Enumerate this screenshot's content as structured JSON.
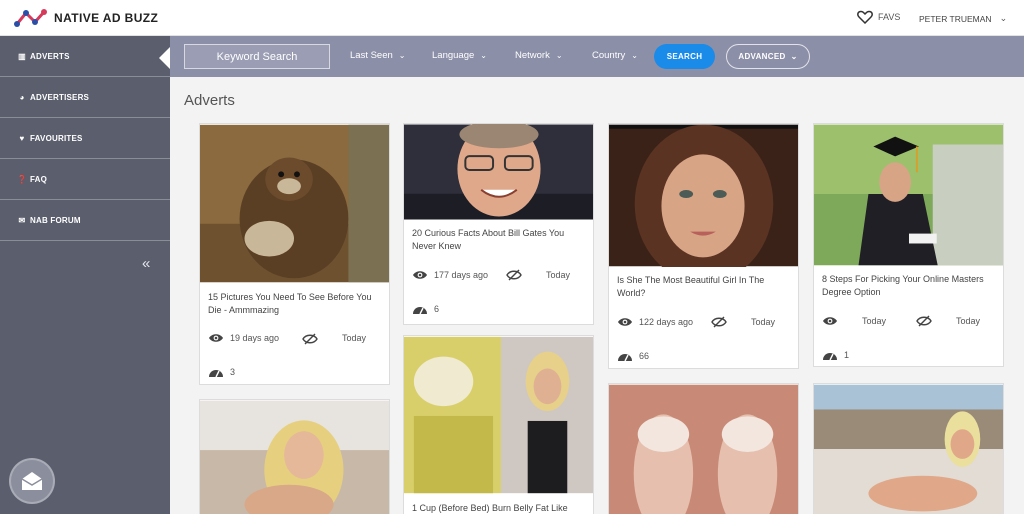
{
  "brand": {
    "name": "NATIVE AD BUZZ"
  },
  "header": {
    "favs_label": "FAVS",
    "user_name": "PETER TRUEMAN"
  },
  "sidebar": {
    "items": [
      {
        "label": "ADVERTS",
        "icon": "bar-chart-icon"
      },
      {
        "label": "ADVERTISERS",
        "icon": "pie-chart-icon"
      },
      {
        "label": "FAVOURITES",
        "icon": "heart-icon"
      },
      {
        "label": "FAQ",
        "icon": "question-icon"
      },
      {
        "label": "NAB FORUM",
        "icon": "chat-icon"
      }
    ],
    "collapse_symbol": "«"
  },
  "filters": {
    "keyword_placeholder": "Keyword Search",
    "last_seen": "Last Seen",
    "language": "Language",
    "network": "Network",
    "country": "Country",
    "search_label": "SEARCH",
    "advanced_label": "ADVANCED"
  },
  "page": {
    "title": "Adverts"
  },
  "cards": [
    {
      "title": "15 Pictures You Need To See Before You Die - Ammmazing",
      "seen": "19 days ago",
      "last": "Today",
      "count": "3"
    },
    {
      "title": "20 Curious Facts About Bill Gates You Never Knew",
      "seen": "177 days ago",
      "last": "Today",
      "count": "6"
    },
    {
      "title": "Is She The Most Beautiful Girl In The World?",
      "seen": "122 days ago",
      "last": "Today",
      "count": "66"
    },
    {
      "title": "8 Steps For Picking Your Online Masters Degree Option",
      "seen": "Today",
      "last": "Today",
      "count": "1"
    },
    {
      "title": "",
      "seen": "",
      "last": "",
      "count": ""
    },
    {
      "title": "1 Cup (Before Bed) Burn Belly Fat Like",
      "seen": "",
      "last": "",
      "count": ""
    },
    {
      "title": "",
      "seen": "",
      "last": "",
      "count": ""
    },
    {
      "title": "",
      "seen": "",
      "last": "",
      "count": ""
    }
  ],
  "colors": {
    "sidebar_bg": "#5b5e6d",
    "filterbar_bg": "#8c8fa8",
    "search_button": "#1a8be8",
    "page_bg": "#f3f3f3"
  }
}
